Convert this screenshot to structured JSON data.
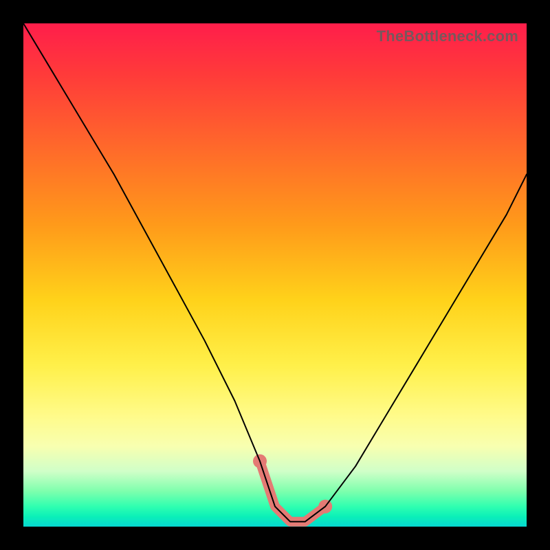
{
  "watermark": "TheBottleneck.com",
  "chart_data": {
    "type": "line",
    "title": "",
    "xlabel": "",
    "ylabel": "",
    "xlim": [
      0,
      100
    ],
    "ylim": [
      0,
      100
    ],
    "grid": false,
    "legend": false,
    "series": [
      {
        "name": "bottleneck-curve",
        "color": "#000000",
        "x": [
          0,
          6,
          12,
          18,
          24,
          30,
          36,
          42,
          47,
          50,
          53,
          56,
          60,
          66,
          72,
          78,
          84,
          90,
          96,
          100
        ],
        "values": [
          100,
          90,
          80,
          70,
          59,
          48,
          37,
          25,
          13,
          4,
          1,
          1,
          4,
          12,
          22,
          32,
          42,
          52,
          62,
          70
        ]
      }
    ],
    "highlight": {
      "name": "optimal-range",
      "color": "#e47a74",
      "x": [
        47,
        50,
        53,
        56,
        60
      ],
      "values": [
        13,
        4,
        1,
        1,
        4
      ],
      "endpoints": [
        {
          "x": 47,
          "y": 13
        },
        {
          "x": 60,
          "y": 4
        }
      ]
    }
  }
}
